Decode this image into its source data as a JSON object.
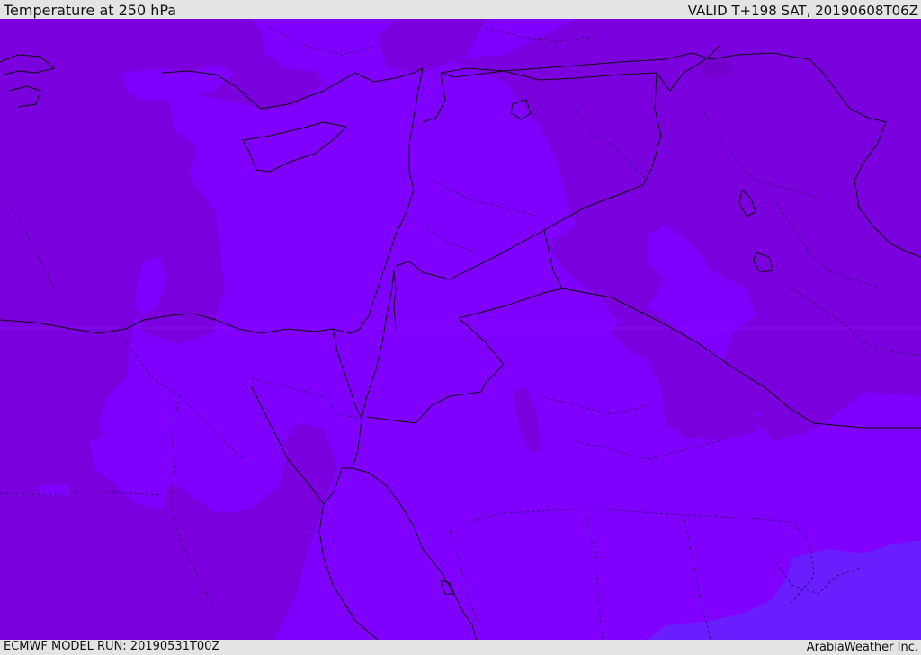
{
  "header": {
    "title": "Temperature at 250 hPa",
    "valid_time": "VALID T+198 SAT, 20190608T06Z"
  },
  "footer": {
    "model_run": "ECMWF MODEL RUN: 20190531T00Z",
    "credit": "ArabiaWeather Inc."
  },
  "map": {
    "variable": "temperature",
    "level": "250 hPa",
    "colors": {
      "colder": "#7a00dd",
      "cold": "#7f00ff",
      "warmer": "#6a1eff",
      "coastline": "#111111",
      "borders": "#222222"
    },
    "icons": [
      "coastline-layer",
      "country-border-layer",
      "temperature-shading-layer"
    ]
  }
}
